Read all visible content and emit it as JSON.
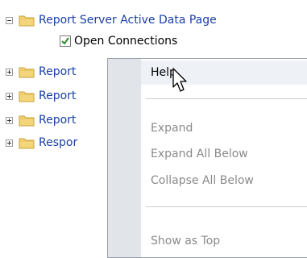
{
  "tree": {
    "root": {
      "label": "Report Server Active Data Page",
      "expanded": true,
      "children": [
        {
          "label": "Open Connections",
          "checked": true
        }
      ]
    },
    "collapsed_nodes": [
      {
        "label": "Report"
      },
      {
        "label": "Report"
      },
      {
        "label": "Report"
      },
      {
        "label": "Respor"
      }
    ]
  },
  "context_menu": {
    "items": [
      {
        "label": "Help",
        "state": "highlighted"
      },
      {
        "label": "Expand",
        "state": "disabled"
      },
      {
        "label": "Expand All Below",
        "state": "disabled"
      },
      {
        "label": "Collapse All Below",
        "state": "disabled"
      },
      {
        "label": "Show as Top",
        "state": "disabled"
      }
    ]
  },
  "icons": {
    "folder": "folder-icon",
    "expand": "plus-box-icon",
    "collapse": "minus-box-icon",
    "checkbox": "checkmark-icon",
    "cursor": "mouse-pointer-icon"
  },
  "colors": {
    "link_text": "#1a3fa6",
    "folder_fill": "#f3d57a",
    "check_green": "#2e8b2e",
    "menu_gutter": "#e1e4e8",
    "disabled_text": "#8a8a8a"
  }
}
